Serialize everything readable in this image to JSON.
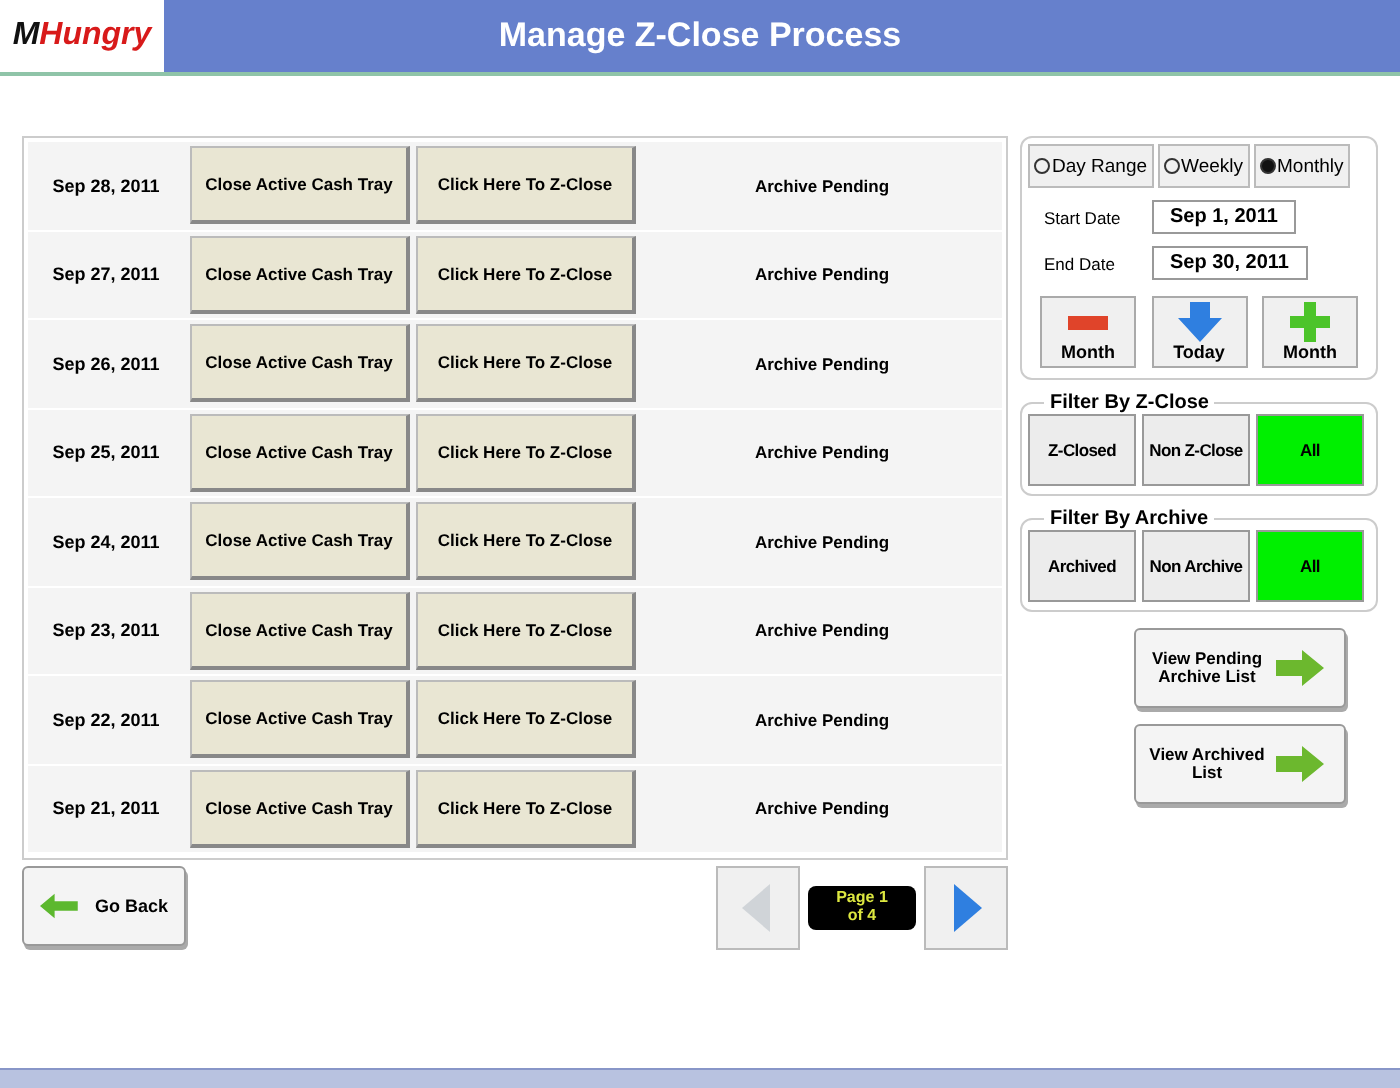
{
  "logo": {
    "mark": "M",
    "text": "Hungry"
  },
  "title": "Manage Z-Close Process",
  "rows": [
    {
      "date": "Sep 28, 2011",
      "cash_button": "Close Active Cash Tray",
      "zclose_button": "Click Here To Z-Close",
      "status": "Archive Pending"
    },
    {
      "date": "Sep 27, 2011",
      "cash_button": "Close Active Cash Tray",
      "zclose_button": "Click Here To Z-Close",
      "status": "Archive Pending"
    },
    {
      "date": "Sep 26, 2011",
      "cash_button": "Close Active Cash Tray",
      "zclose_button": "Click Here To Z-Close",
      "status": "Archive Pending"
    },
    {
      "date": "Sep 25, 2011",
      "cash_button": "Close Active Cash Tray",
      "zclose_button": "Click Here To Z-Close",
      "status": "Archive Pending"
    },
    {
      "date": "Sep 24, 2011",
      "cash_button": "Close Active Cash Tray",
      "zclose_button": "Click Here To Z-Close",
      "status": "Archive Pending"
    },
    {
      "date": "Sep 23, 2011",
      "cash_button": "Close Active Cash Tray",
      "zclose_button": "Click Here To Z-Close",
      "status": "Archive Pending"
    },
    {
      "date": "Sep 22, 2011",
      "cash_button": "Close Active Cash Tray",
      "zclose_button": "Click Here To Z-Close",
      "status": "Archive Pending"
    },
    {
      "date": "Sep 21, 2011",
      "cash_button": "Close Active Cash Tray",
      "zclose_button": "Click Here To Z-Close",
      "status": "Archive Pending"
    }
  ],
  "range_options": [
    {
      "label": "Day Range",
      "selected": false
    },
    {
      "label": "Weekly",
      "selected": false
    },
    {
      "label": "Monthly",
      "selected": true
    }
  ],
  "start_date": {
    "label": "Start Date",
    "value": "Sep 1, 2011"
  },
  "end_date": {
    "label": "End Date",
    "value": "Sep 30, 2011"
  },
  "date_buttons": [
    {
      "kind": "minus",
      "label": "Month"
    },
    {
      "kind": "down",
      "label": "Today"
    },
    {
      "kind": "plus",
      "label": "Month"
    }
  ],
  "filter_zclose": {
    "title": "Filter By Z-Close",
    "options": [
      {
        "label": "Z-Closed",
        "selected": false
      },
      {
        "label": "Non Z-Close",
        "selected": false
      },
      {
        "label": "All",
        "selected": true
      }
    ]
  },
  "filter_archive": {
    "title": "Filter By Archive",
    "options": [
      {
        "label": "Archived",
        "selected": false
      },
      {
        "label": "Non Archive",
        "selected": false
      },
      {
        "label": "All",
        "selected": true
      }
    ]
  },
  "view_buttons": [
    "View Pending Archive List",
    "View Archived List"
  ],
  "back_button": "Go Back",
  "pager": {
    "prev_disabled": true,
    "next_disabled": false,
    "label": "Page 1 of 4"
  }
}
